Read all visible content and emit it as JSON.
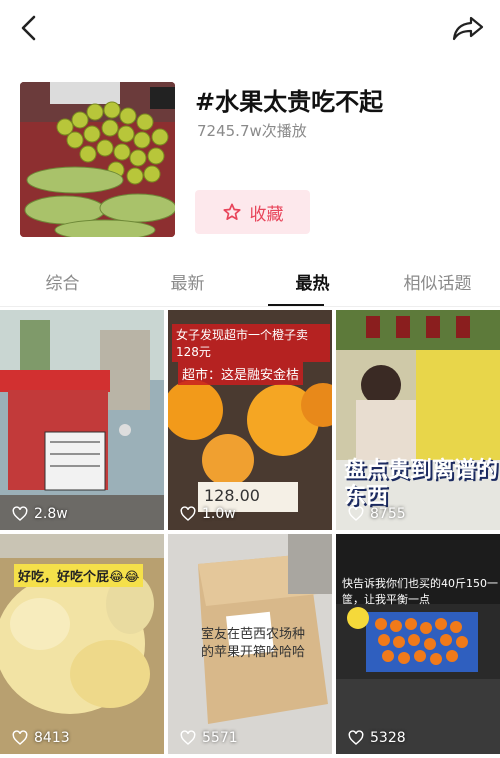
{
  "topic": {
    "title": "#水果太贵吃不起",
    "plays": "7245.7w次播放",
    "favorite_label": "收藏"
  },
  "tabs": [
    {
      "label": "综合",
      "active": false
    },
    {
      "label": "最新",
      "active": false
    },
    {
      "label": "最热",
      "active": true
    },
    {
      "label": "相似话题",
      "active": false
    }
  ],
  "videos": [
    {
      "likes": "2.8w"
    },
    {
      "likes": "1.0w",
      "caption_top": "女子发现超市一个橙子卖128元",
      "caption_sub": "超市：这是融安金桔",
      "price": "128.00"
    },
    {
      "likes": "8755",
      "caption": "盘点贵到离谱的东西"
    },
    {
      "likes": "8413",
      "caption": "好吃，好吃个屁😂😂"
    },
    {
      "likes": "5571",
      "caption": "室友在芭西农场种的苹果开箱哈哈哈"
    },
    {
      "likes": "5328",
      "caption": "快告诉我你们也买的40斤150一筐，让我平衡一点"
    }
  ],
  "icons": {
    "back": "chevron-left-icon",
    "share": "share-arrow-icon",
    "favorite": "star-outline-icon",
    "like": "heart-outline-icon"
  },
  "colors": {
    "accent": "#e8445a",
    "fav_bg": "#fde8ec"
  }
}
